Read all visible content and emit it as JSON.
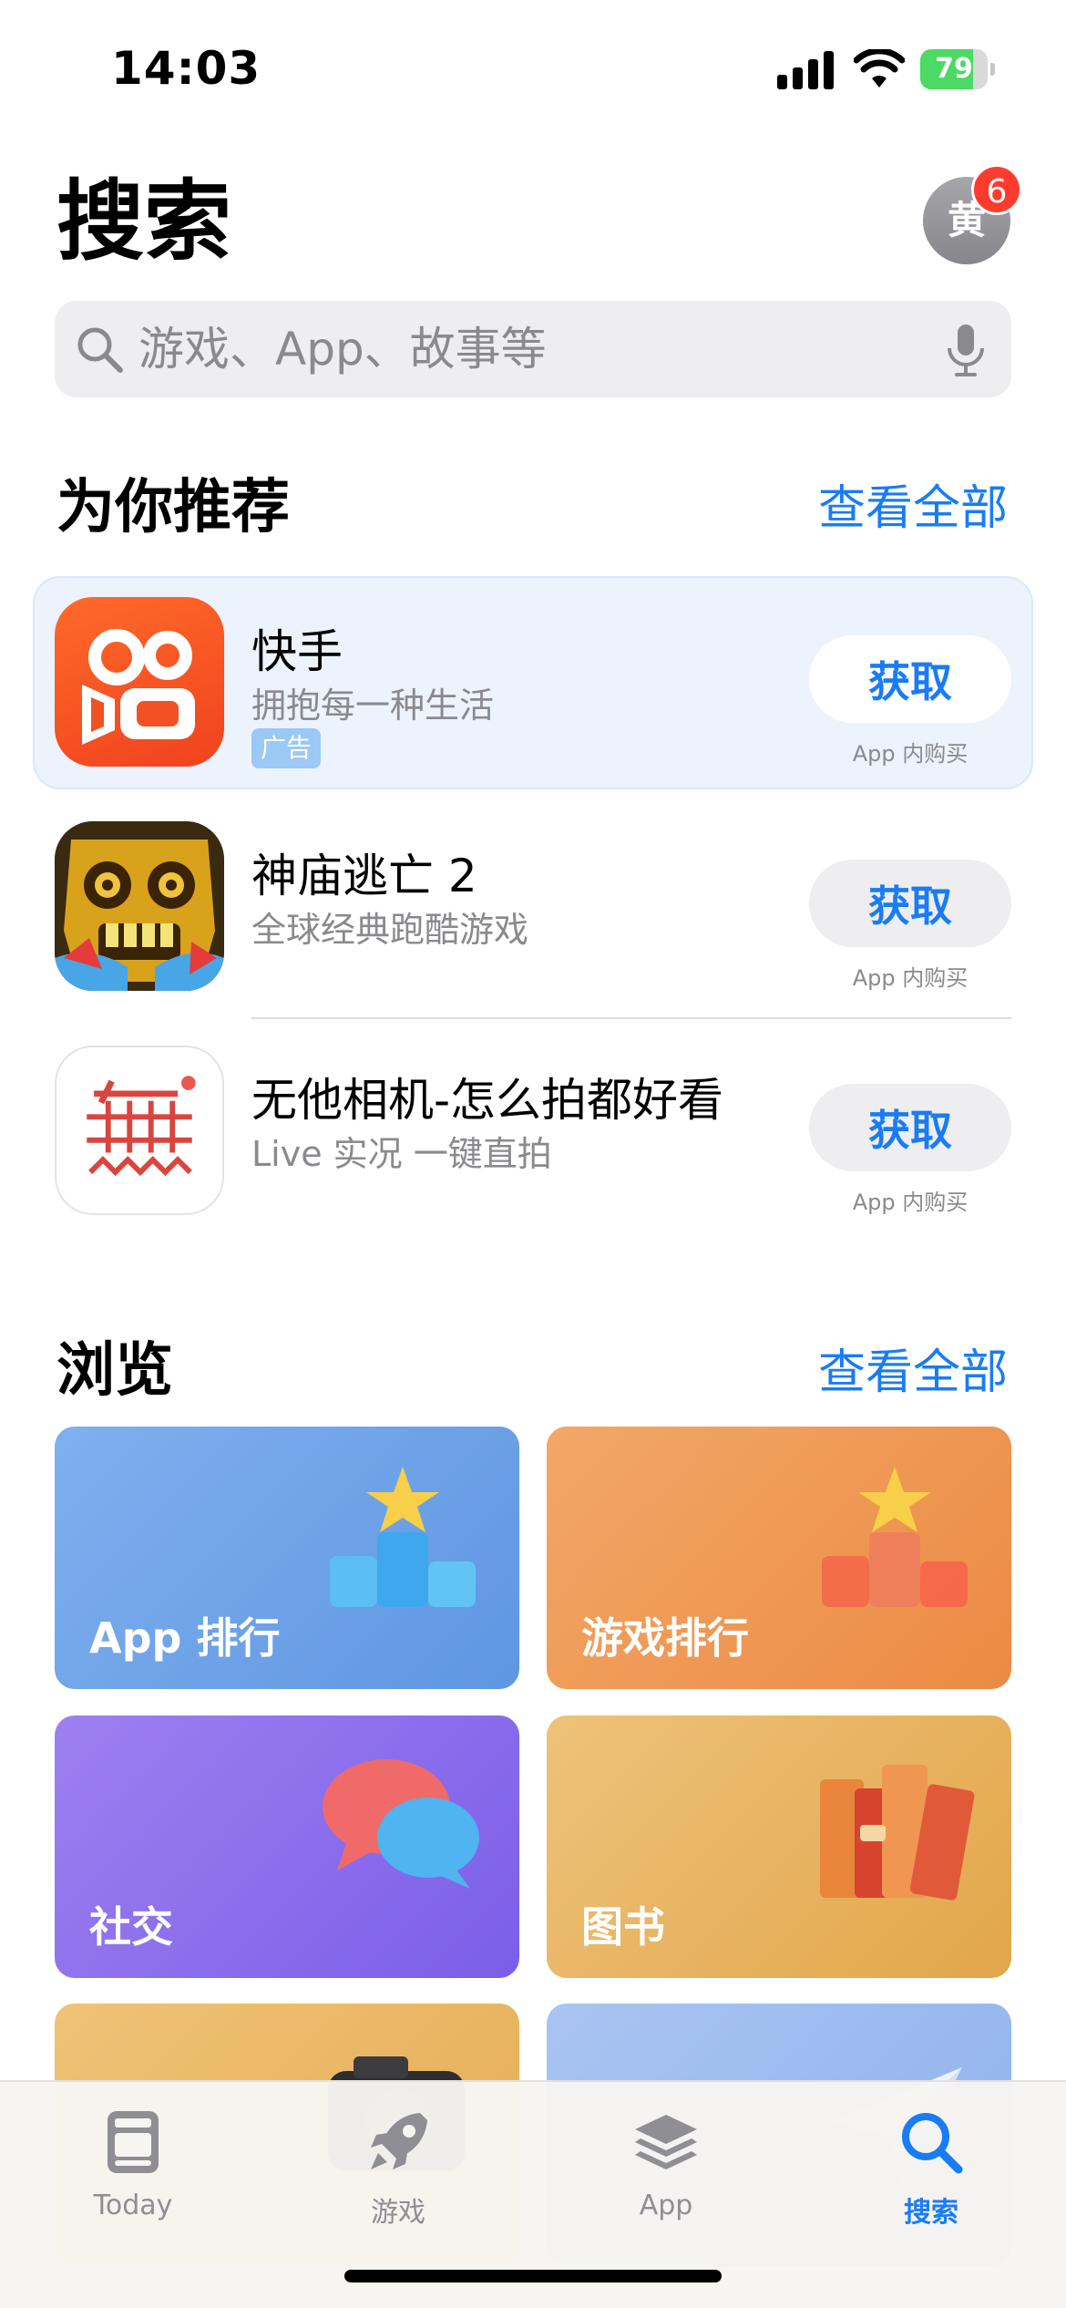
{
  "status_bar": {
    "time": "14:03",
    "battery_percent": 79,
    "battery_text": "79"
  },
  "header": {
    "title": "搜索",
    "avatar_initial": "黄",
    "badge_count": "6"
  },
  "search": {
    "placeholder": "游戏、App、故事等",
    "value": ""
  },
  "recommended": {
    "title": "为你推荐",
    "see_all": "查看全部",
    "apps": [
      {
        "name": "快手",
        "subtitle": "拥抱每一种生活",
        "ad_label": "广告",
        "button": "获取",
        "note": "App 内购买",
        "icon": "kuaishou-icon"
      },
      {
        "name": "神庙逃亡 2",
        "subtitle": "全球经典跑酷游戏",
        "button": "获取",
        "note": "App 内购买",
        "icon": "temple-run-icon"
      },
      {
        "name": "无他相机-怎么拍都好看",
        "subtitle": "Live 实况 一键直拍",
        "button": "获取",
        "note": "App 内购买",
        "icon": "wuta-camera-icon"
      }
    ]
  },
  "browse": {
    "title": "浏览",
    "see_all": "查看全部",
    "tiles": [
      {
        "label": "App 排行",
        "icon": "podium-star-icon",
        "color": "#6fa1ea"
      },
      {
        "label": "游戏排行",
        "icon": "podium-star-icon",
        "color": "#ef9450"
      },
      {
        "label": "社交",
        "icon": "chat-bubbles-icon",
        "color": "#8c6bee"
      },
      {
        "label": "图书",
        "icon": "books-icon",
        "color": "#e4ac55"
      },
      {
        "label": "",
        "icon": "camera-icon",
        "color": "#e9b65e"
      },
      {
        "label": "",
        "icon": "paper-plane-icon",
        "color": "#9dbcef"
      }
    ]
  },
  "tab_bar": {
    "tabs": [
      {
        "label": "Today",
        "icon": "today-icon",
        "active": false
      },
      {
        "label": "游戏",
        "icon": "rocket-icon",
        "active": false
      },
      {
        "label": "App",
        "icon": "layers-icon",
        "active": false
      },
      {
        "label": "搜索",
        "icon": "search-icon",
        "active": true
      }
    ]
  },
  "colors": {
    "accent": "#1a7cf5",
    "badge": "#ff3b30",
    "battery": "#4cd964"
  }
}
